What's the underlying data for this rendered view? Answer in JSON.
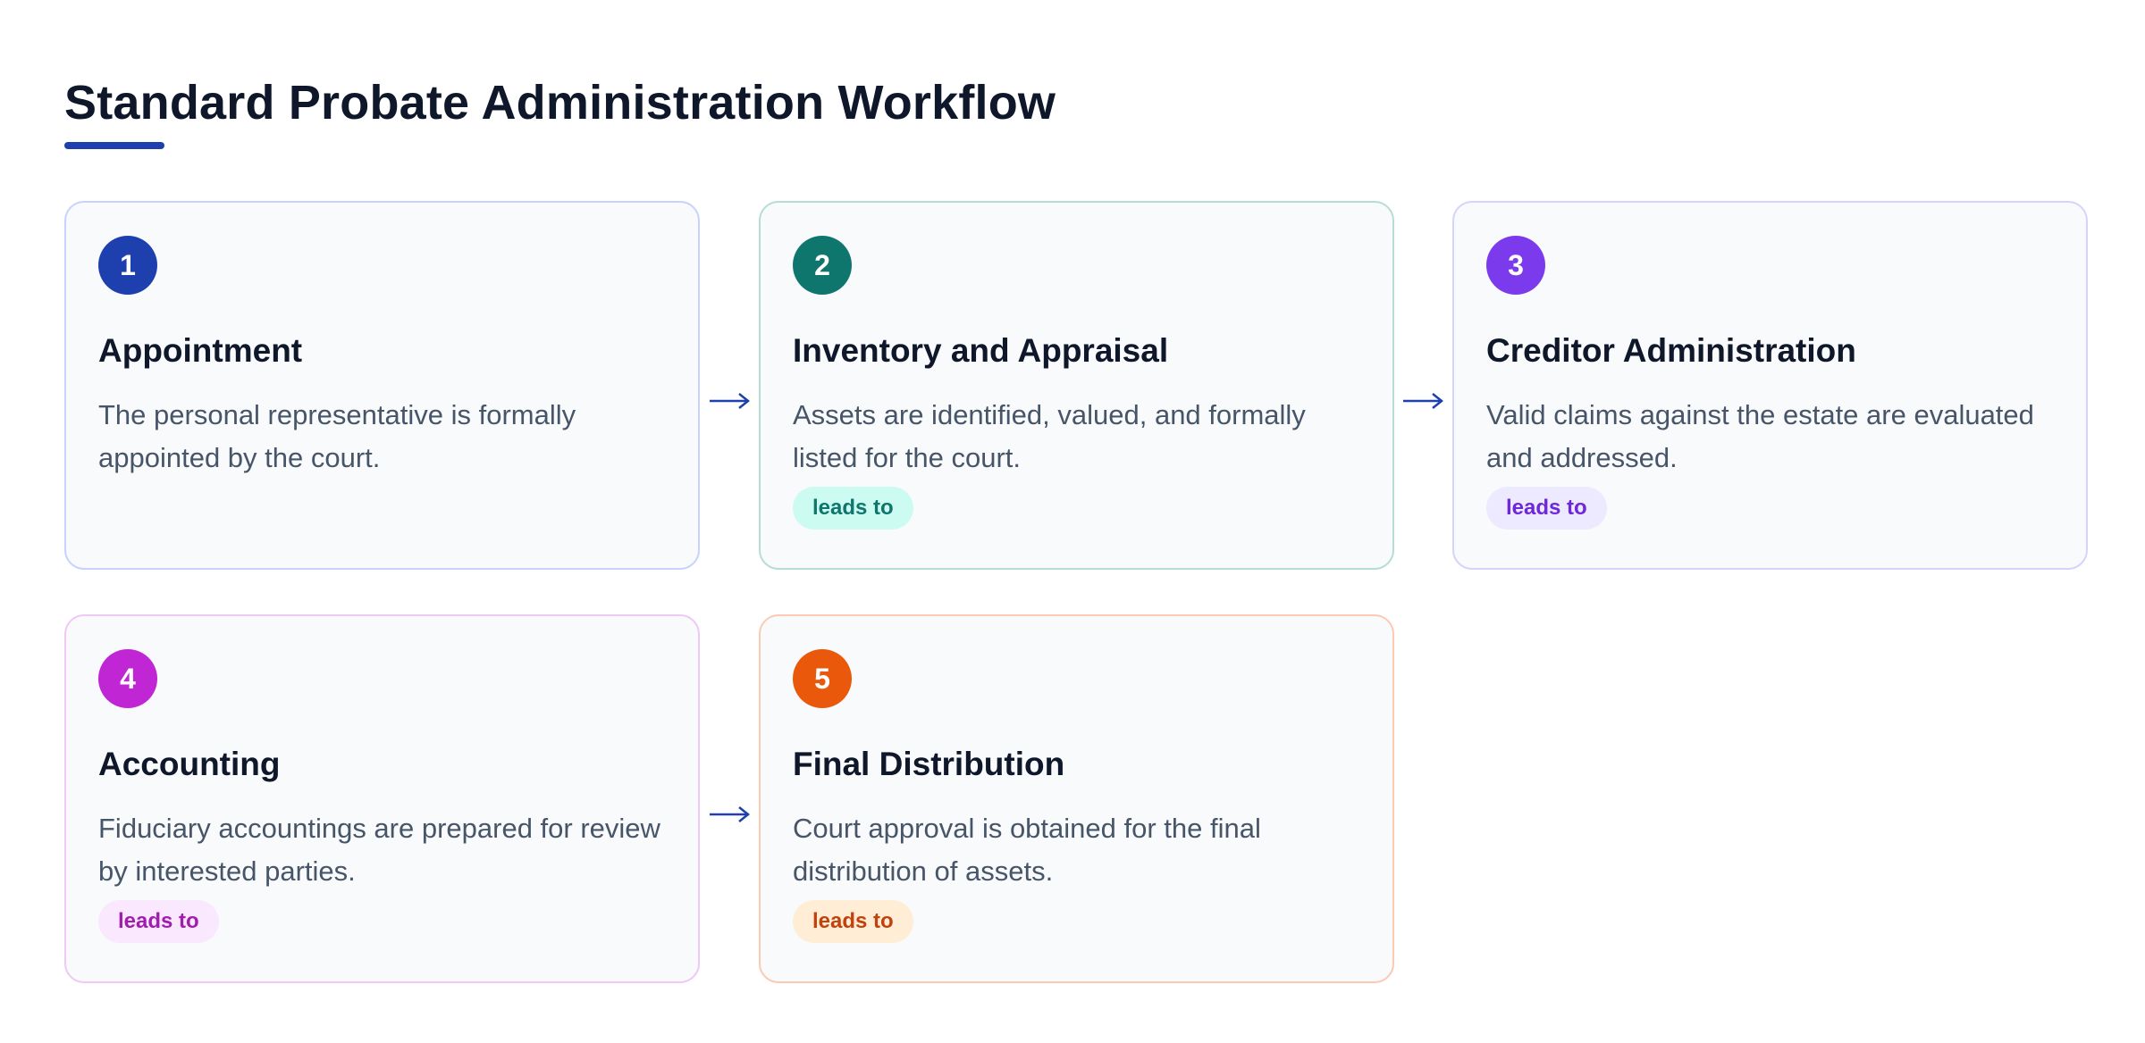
{
  "title": "Standard Probate Administration Workflow",
  "colors": {
    "accent": "#1e40af",
    "arrow": "#1e40af"
  },
  "steps": [
    {
      "number": "1",
      "title": "Appointment",
      "description": "The personal representative is formally appointed by the court.",
      "color": "#1e40af"
    },
    {
      "number": "2",
      "title": "Inventory and Appraisal",
      "description": "Assets are identified, valued, and formally listed for the court.",
      "chip": "leads to",
      "color": "#0f766e",
      "chip_bg": "#ccfbf1",
      "chip_text": "#0f766e"
    },
    {
      "number": "3",
      "title": "Creditor Administration",
      "description": "Valid claims against the estate are evaluated and addressed.",
      "chip": "leads to",
      "color": "#7c3aed",
      "chip_bg": "#ede9fe",
      "chip_text": "#6d28d9"
    },
    {
      "number": "4",
      "title": "Accounting",
      "description": "Fiduciary accountings are prepared for review by interested parties.",
      "chip": "leads to",
      "color": "#c026d3",
      "chip_bg": "#fae8ff",
      "chip_text": "#a21caf"
    },
    {
      "number": "5",
      "title": "Final Distribution",
      "description": "Court approval is obtained for the final distribution of assets.",
      "chip": "leads to",
      "color": "#ea580c",
      "chip_bg": "#ffedd5",
      "chip_text": "#c2410c"
    }
  ]
}
